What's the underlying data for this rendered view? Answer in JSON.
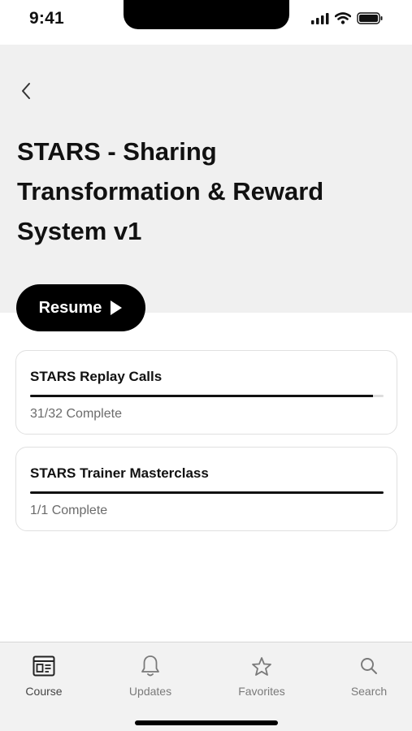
{
  "status_bar": {
    "time": "9:41",
    "icons": [
      "cellular-signal-icon",
      "wifi-icon",
      "battery-icon"
    ]
  },
  "header": {
    "back_icon": "chevron-left-icon",
    "title": "STARS - Sharing Transformation & Reward System v1"
  },
  "resume_button": {
    "label": "Resume",
    "icon": "play-icon"
  },
  "modules": [
    {
      "title": "STARS Replay Calls",
      "status": "31/32 Complete",
      "progress": 0.97
    },
    {
      "title": "STARS Trainer Masterclass",
      "status": "1/1 Complete",
      "progress": 1.0
    }
  ],
  "tab_bar": {
    "active": "Course",
    "tabs": [
      {
        "label": "Course",
        "icon": "course-icon"
      },
      {
        "label": "Updates",
        "icon": "bell-icon"
      },
      {
        "label": "Favorites",
        "icon": "star-icon"
      },
      {
        "label": "Search",
        "icon": "search-icon"
      }
    ]
  },
  "colors": {
    "header_background": "#f0f0f0",
    "primary": "#000000",
    "tab_bar_background": "#f2f2f2",
    "muted_text": "#6b6b6b"
  }
}
